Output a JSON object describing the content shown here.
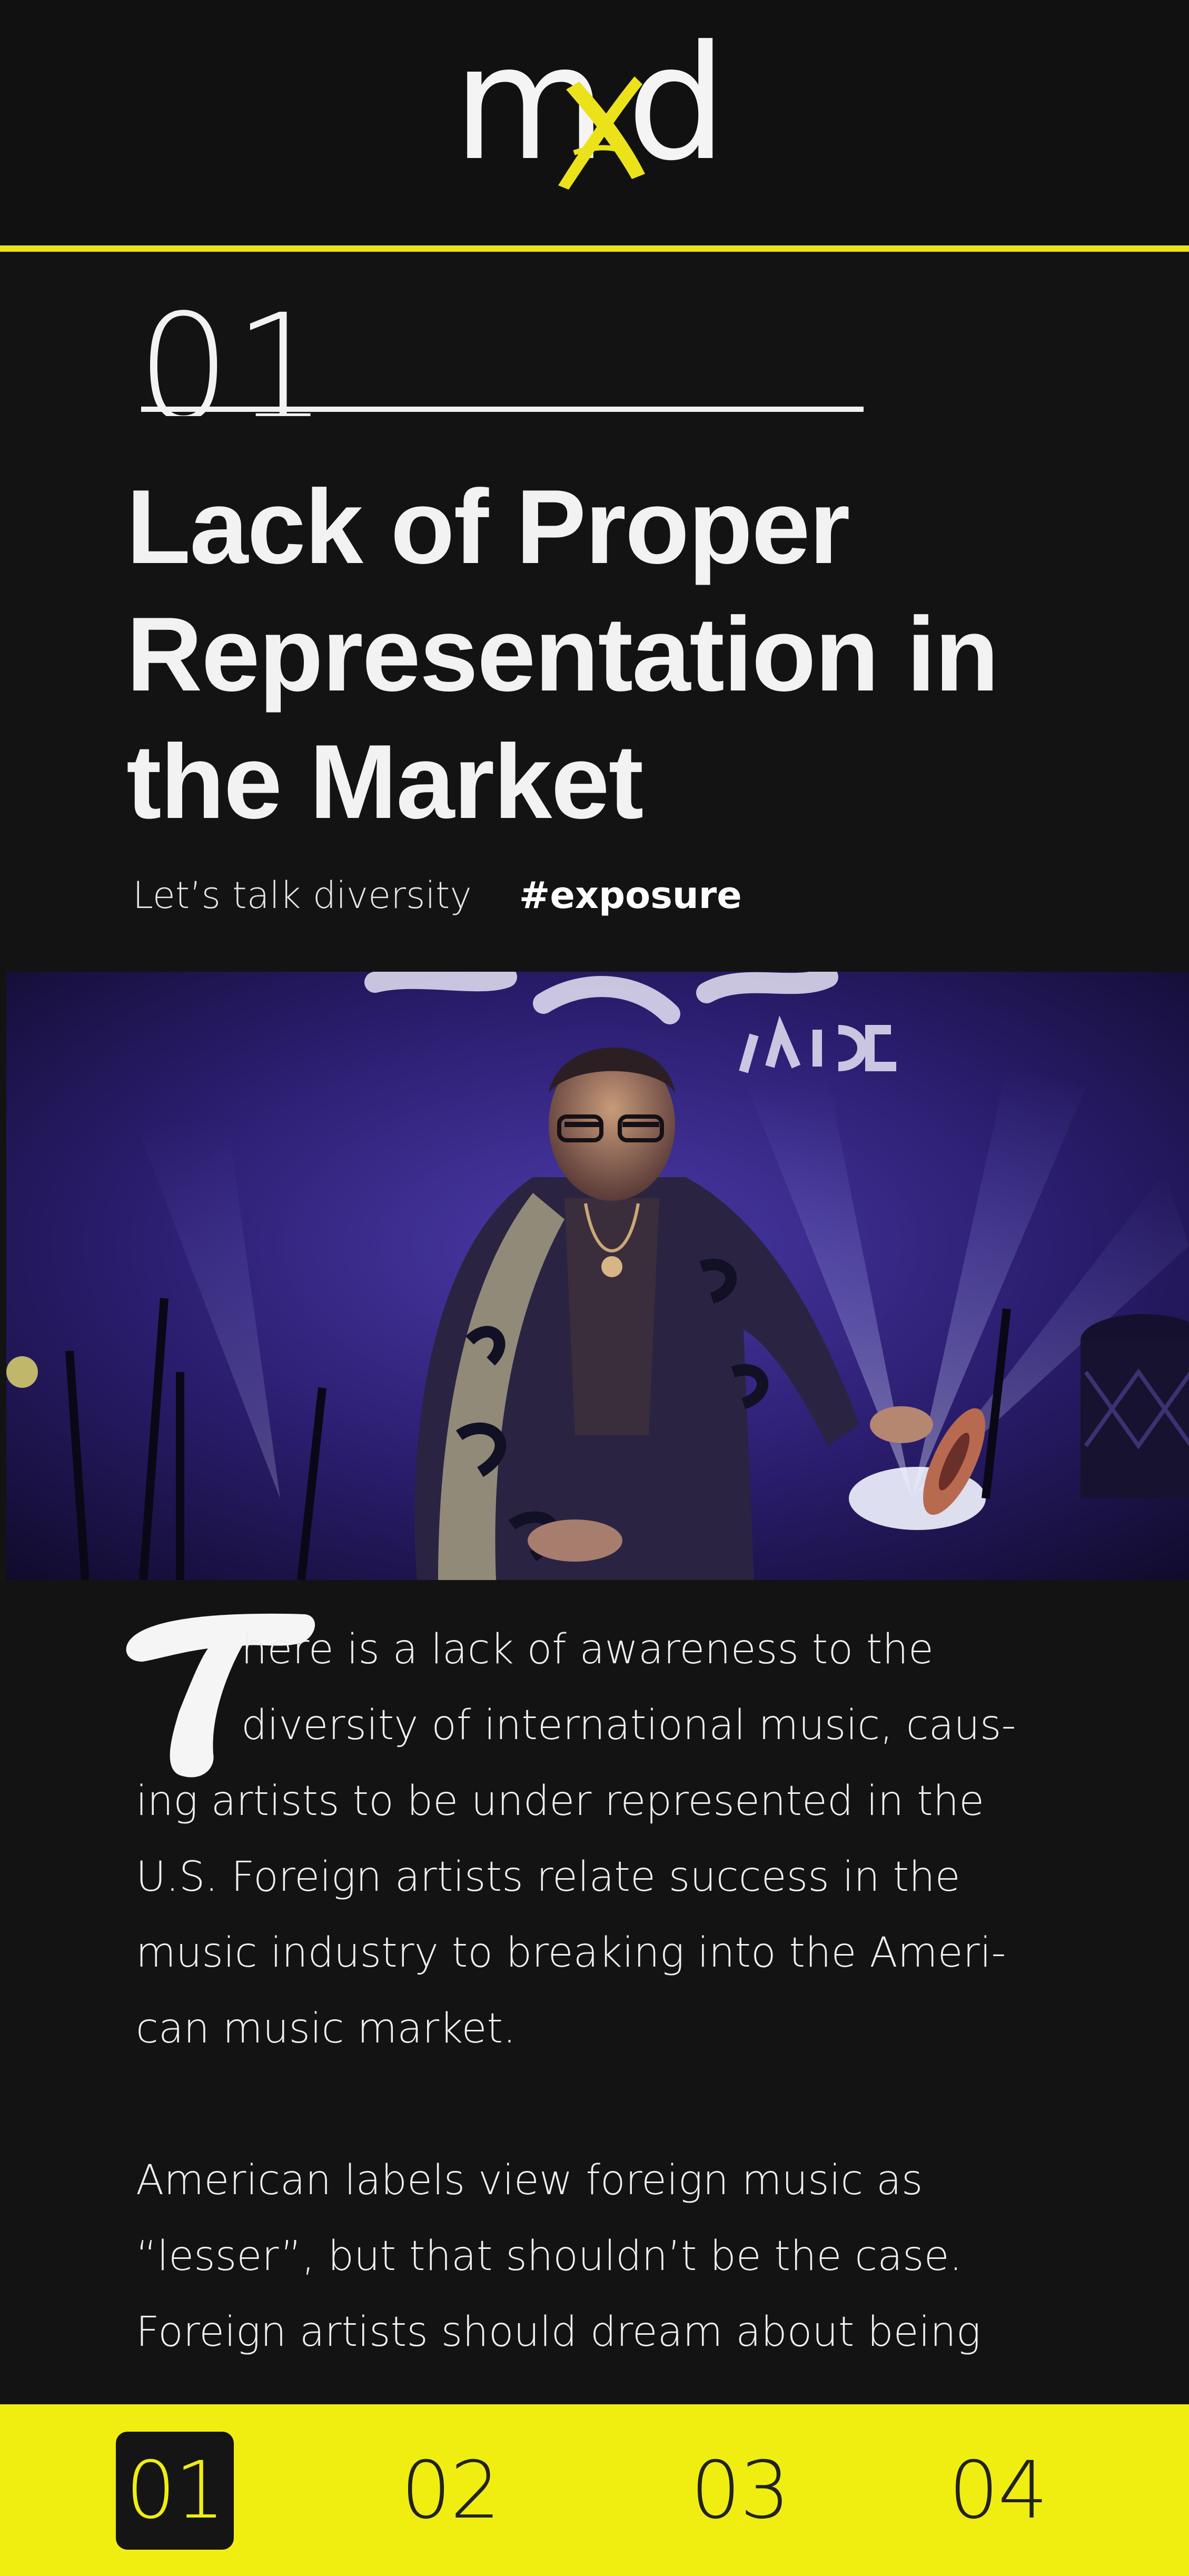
{
  "header": {
    "logo": {
      "text": "mxd",
      "accent_color": "#ece21a"
    },
    "rule_color": "#ece21a"
  },
  "article": {
    "section_number": "01",
    "title_lines": [
      "Lack of Proper",
      "Representation in",
      "the Market"
    ],
    "subtitle": "Let’s talk diversity",
    "hashtag": "#exposure",
    "hero_image": {
      "alt": "Performer in a patterned kimono playing cymbals on stage under purple light"
    },
    "drop_cap": "T",
    "paragraph1_lines": [
      "here is a lack of awareness to the",
      "diversity of international music, caus-",
      "ing artists to be under represented in the",
      "U.S. Foreign artists relate success in the",
      "music industry to breaking into the Ameri-",
      "can music market."
    ],
    "paragraph2_lines": [
      "American labels view foreign music as",
      "“lesser”, but that shouldn’t be the case.",
      "Foreign artists should dream about being"
    ]
  },
  "bottom_nav": {
    "items": [
      {
        "label": "01",
        "active": true
      },
      {
        "label": "02",
        "active": false
      },
      {
        "label": "03",
        "active": false
      },
      {
        "label": "04",
        "active": false
      }
    ],
    "background": "#f0ee10"
  }
}
